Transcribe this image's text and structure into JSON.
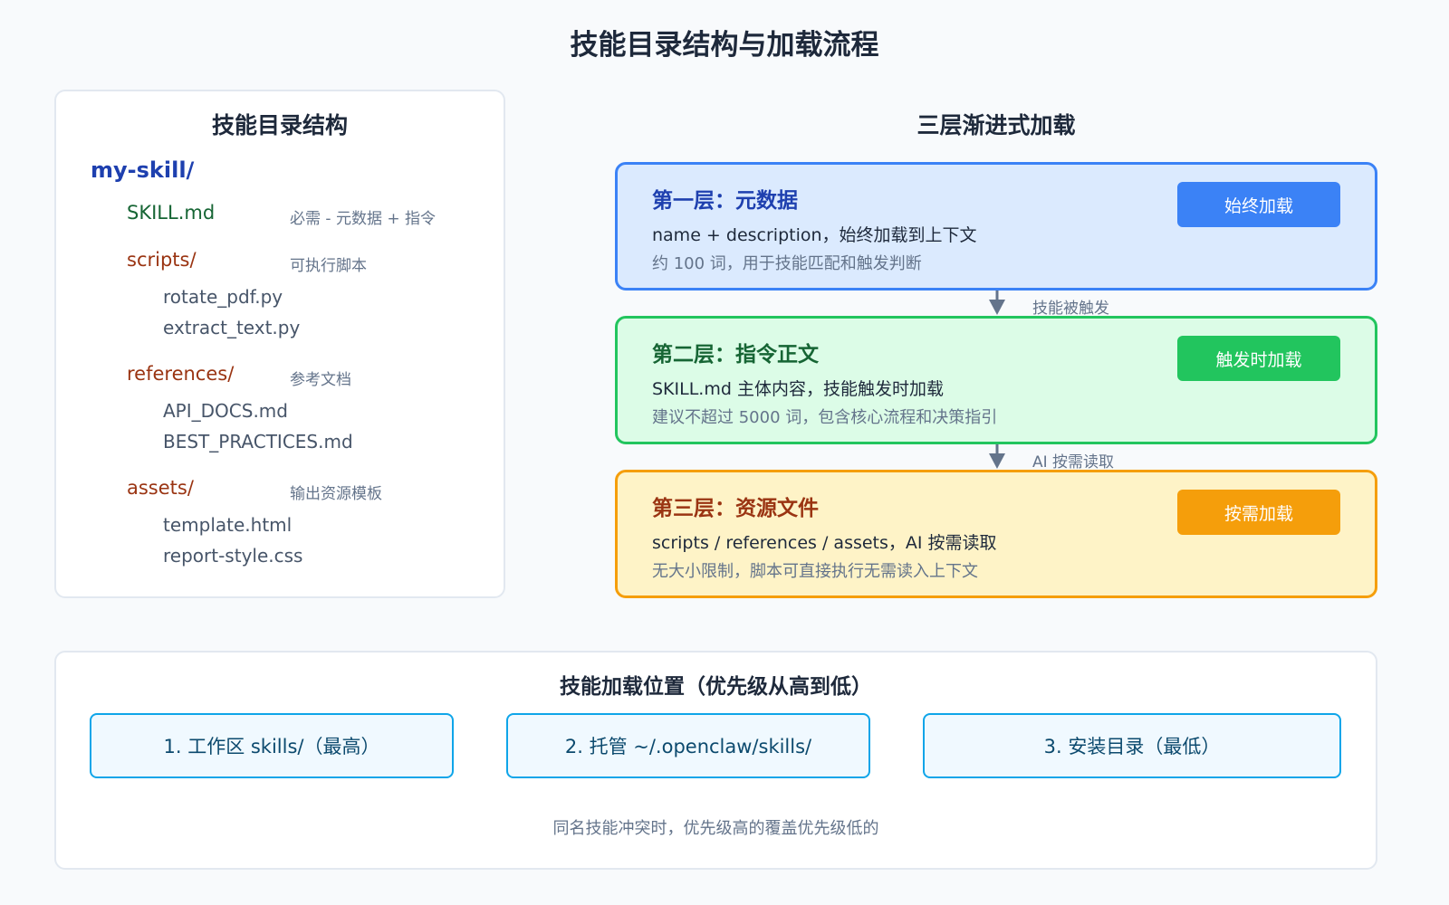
{
  "title": "技能目录结构与加载流程",
  "directory": {
    "title": "技能目录结构",
    "root": "my-skill/",
    "skill_file": {
      "name": "SKILL.md",
      "note": "必需 - 元数据 + 指令"
    },
    "scripts": {
      "name": "scripts/",
      "note": "可执行脚本",
      "files": [
        "rotate_pdf.py",
        "extract_text.py"
      ]
    },
    "references": {
      "name": "references/",
      "note": "参考文档",
      "files": [
        "API_DOCS.md",
        "BEST_PRACTICES.md"
      ]
    },
    "assets": {
      "name": "assets/",
      "note": "输出资源模板",
      "files": [
        "template.html",
        "report-style.css"
      ]
    }
  },
  "layers": {
    "title": "三层渐进式加载",
    "items": [
      {
        "title": "第一层：元数据",
        "desc": "name + description，始终加载到上下文",
        "sub": "约 100 词，用于技能匹配和触发判断",
        "badge": "始终加载"
      },
      {
        "title": "第二层：指令正文",
        "desc": "SKILL.md 主体内容，技能触发时加载",
        "sub": "建议不超过 5000 词，包含核心流程和决策指引",
        "badge": "触发时加载"
      },
      {
        "title": "第三层：资源文件",
        "desc": "scripts / references / assets，AI 按需读取",
        "sub": "无大小限制，脚本可直接执行无需读入上下文",
        "badge": "按需加载"
      }
    ],
    "arrows": [
      "技能被触发",
      "AI 按需读取"
    ]
  },
  "locations": {
    "title": "技能加载位置（优先级从高到低）",
    "items": [
      "1. 工作区 skills/（最高）",
      "2. 托管 ~/.openclaw/skills/",
      "3. 安装目录（最低）"
    ],
    "note": "同名技能冲突时，优先级高的覆盖优先级低的"
  }
}
